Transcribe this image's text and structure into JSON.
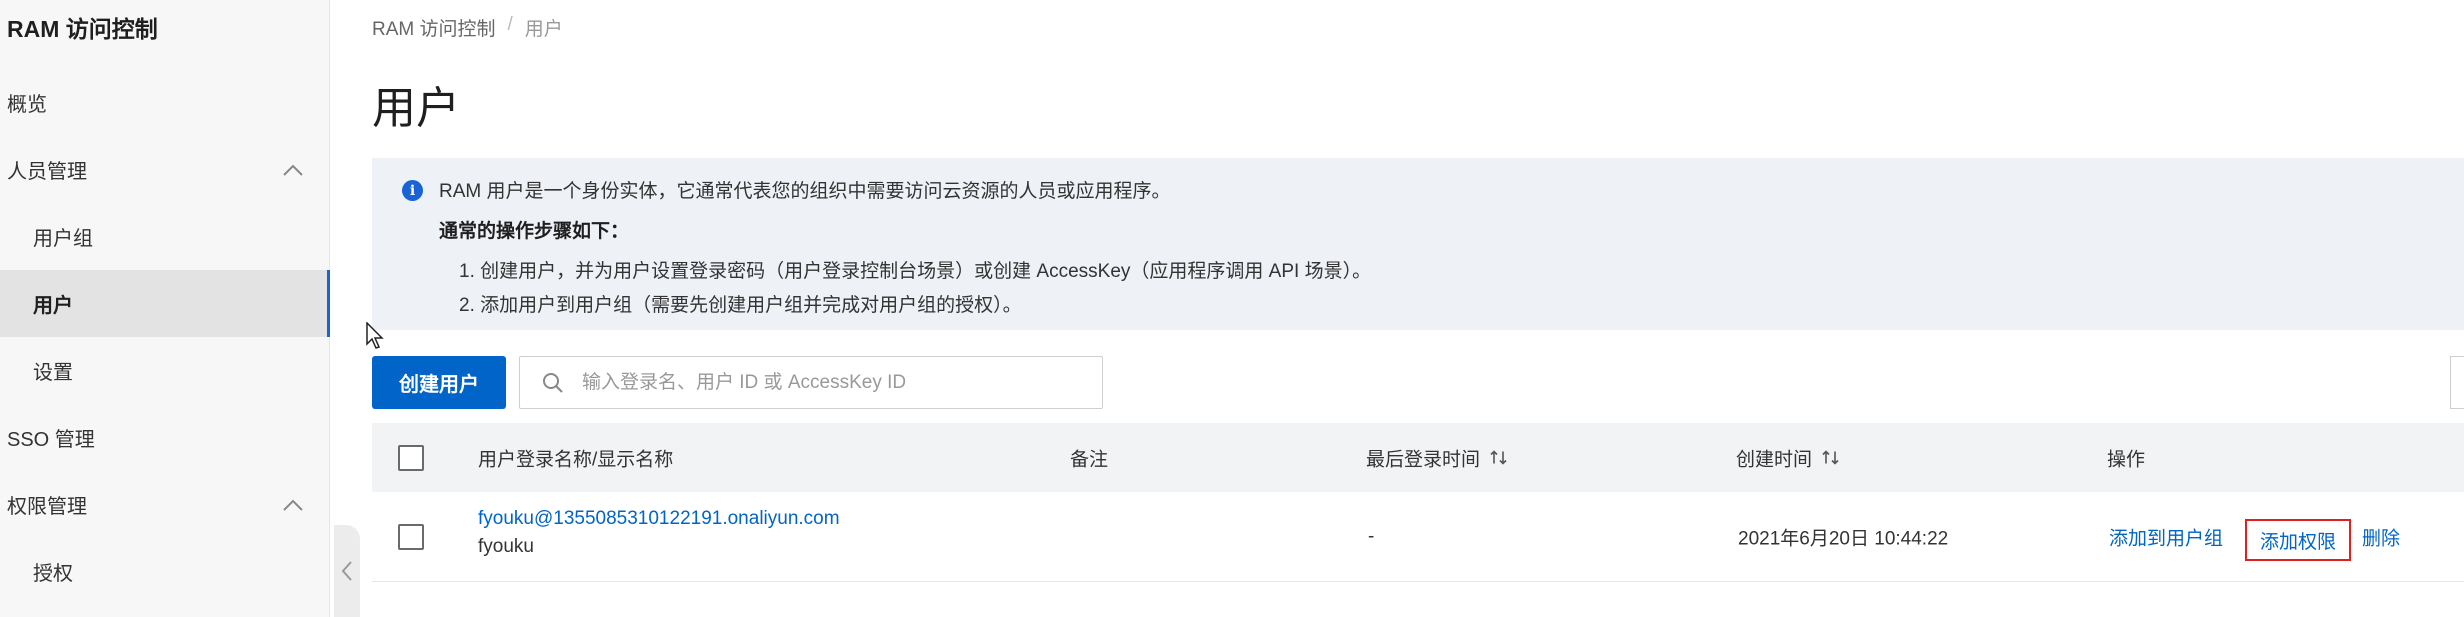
{
  "sidebar": {
    "title": "RAM 访问控制",
    "items": [
      {
        "label": "概览"
      },
      {
        "label": "人员管理"
      },
      {
        "label": "用户组"
      },
      {
        "label": "用户"
      },
      {
        "label": "设置"
      },
      {
        "label": "SSO 管理"
      },
      {
        "label": "权限管理"
      },
      {
        "label": "授权"
      }
    ],
    "active_item": "用户"
  },
  "breadcrumb": {
    "root": "RAM 访问控制",
    "separator": "/",
    "current": "用户"
  },
  "page_title": "用户",
  "notice": {
    "icon": "info-icon",
    "line1": "RAM 用户是一个身份实体，它通常代表您的组织中需要访问云资源的人员或应用程序。",
    "heading": "通常的操作步骤如下：",
    "step1": "1. 创建用户，并为用户设置登录密码（用户登录控制台场景）或创建 AccessKey（应用程序调用 API 场景）。",
    "step2": "2. 添加用户到用户组（需要先创建用户组并完成对用户组的授权）。"
  },
  "toolbar": {
    "create_label": "创建用户",
    "search_placeholder": "输入登录名、用户 ID 或 AccessKey ID"
  },
  "table": {
    "headers": {
      "name": "用户登录名称/显示名称",
      "note": "备注",
      "last_login": "最后登录时间",
      "created": "创建时间",
      "actions": "操作"
    },
    "rows": [
      {
        "login_name": "fyouku@1355085310122191.onaliyun.com",
        "display_name": "fyouku",
        "note": "",
        "last_login": "-",
        "created": "2021年6月20日 10:44:22",
        "actions": {
          "add_to_group": "添加到用户组",
          "add_permission": "添加权限",
          "delete": "删除"
        }
      }
    ]
  },
  "colors": {
    "primary": "#0064c8",
    "highlight_border": "#e02020",
    "notice_bg": "#eef1f6"
  }
}
